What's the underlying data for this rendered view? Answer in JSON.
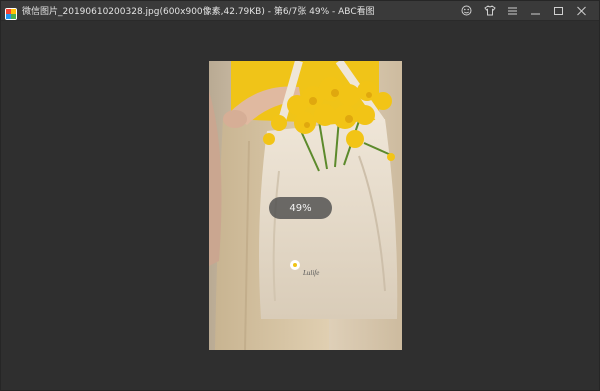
{
  "window": {
    "title": "微信图片_20190610200328.jpg(600x900像素,42.79KB) - 第6/7张 49% - ABC看图"
  },
  "controls": {
    "items": [
      "skin-icon",
      "shirt-icon",
      "menu-icon",
      "minimize-icon",
      "maximize-icon",
      "close-icon"
    ]
  },
  "viewer": {
    "zoom_label": "49%",
    "photo_text": "Lulife"
  },
  "colors": {
    "background": "#2f2f2f",
    "titlebar": "#3a3a3a",
    "accent_yellow": "#f0c418"
  }
}
